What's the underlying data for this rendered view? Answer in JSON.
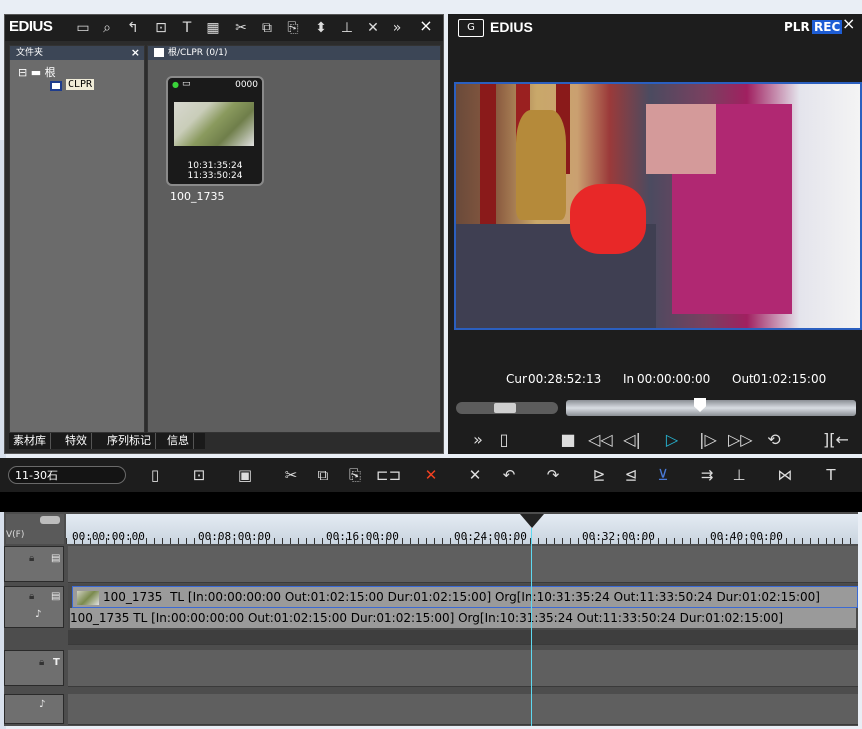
{
  "bin": {
    "logo": "EDIUS",
    "toolbar_icons": [
      "folder-icon",
      "search-icon",
      "up-arrow-icon",
      "add-clip-icon",
      "title-icon",
      "color-bars-icon",
      "cut-icon",
      "copy-icon",
      "paste-icon",
      "marker-icon",
      "insert-icon",
      "delete-icon",
      "more-icon"
    ],
    "close": "×",
    "folder_panel": {
      "title": "文件夹",
      "close": "×",
      "root_label": "根",
      "child_label": "CLPR"
    },
    "clip_panel": {
      "path": "根/CLPR (0/1)"
    },
    "clip": {
      "count": "0000",
      "timecode_in": "10:31:35:24",
      "timecode_out": "11:33:50:24",
      "name": "100_1735"
    },
    "tabs": [
      "素材库",
      "特效",
      "序列标记",
      "信息"
    ]
  },
  "player": {
    "logo": "EDIUS",
    "plr": "PLR",
    "rec": "REC",
    "close": "×",
    "cur_label": "Cur",
    "cur": "00:28:52:13",
    "in_label": "In",
    "in": "00:00:00:00",
    "out_label": "Out",
    "out": "01:02:15:00",
    "controls": {
      "chevrons": "»",
      "mark": "▯",
      "stop": "■",
      "rew": "◁◁",
      "step_back": "◁|",
      "play": "▷",
      "step_fwd": "|▷",
      "ffwd": "▷▷",
      "loop": "⟲",
      "in_out": "][←"
    }
  },
  "timeline": {
    "sequence_name": "11-30石",
    "ruler_labels": [
      "00:00:00:00",
      "00:08:00:00",
      "00:16:00:00",
      "00:24:00:00",
      "00:32:00:00",
      "00:40:00:00"
    ],
    "video_clip_name": "100_1735",
    "video_clip_info": "TL [In:00:00:00:00 Out:01:02:15:00 Dur:01:02:15:00]  Org[In:10:31:35:24 Out:11:33:50:24 Dur:01:02:15:00]",
    "audio_clip_text": "100_1735  TL [In:00:00:00:00 Out:01:02:15:00 Dur:01:02:15:00]  Org[In:10:31:35:24 Out:11:33:50:24 Dur:01:02:15:00]",
    "track_header_label": "V(F)"
  }
}
